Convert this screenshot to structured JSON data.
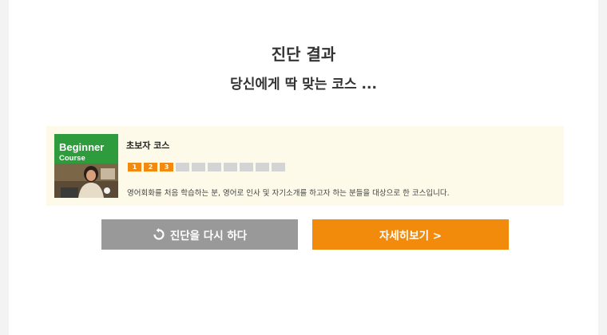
{
  "header": {
    "title": "진단 결과",
    "subtitle": "당신에게 딱 맞는 코스 ..."
  },
  "course": {
    "thumb_title": "Beginner",
    "thumb_subtitle": "Course",
    "name": "초보자 코스",
    "steps": [
      {
        "label": "1",
        "active": true
      },
      {
        "label": "2",
        "active": true
      },
      {
        "label": "3",
        "active": true
      },
      {
        "label": "",
        "active": false
      },
      {
        "label": "",
        "active": false
      },
      {
        "label": "",
        "active": false
      },
      {
        "label": "",
        "active": false
      },
      {
        "label": "",
        "active": false
      },
      {
        "label": "",
        "active": false
      },
      {
        "label": "",
        "active": false
      }
    ],
    "description": "영어회화를 처음 학습하는 분, 영어로 인사 및 자기소개를 하고자 하는 분들을 대상으로 한 코스입니다."
  },
  "buttons": {
    "retry_label": "진단을 다시 하다",
    "retry_icon": "refresh-icon",
    "detail_label": "자세히보기 >"
  },
  "colors": {
    "accent": "#f28b0c",
    "thumb_green": "#2e9b3c",
    "card_bg": "#fdfae9",
    "secondary_button": "#999999"
  }
}
